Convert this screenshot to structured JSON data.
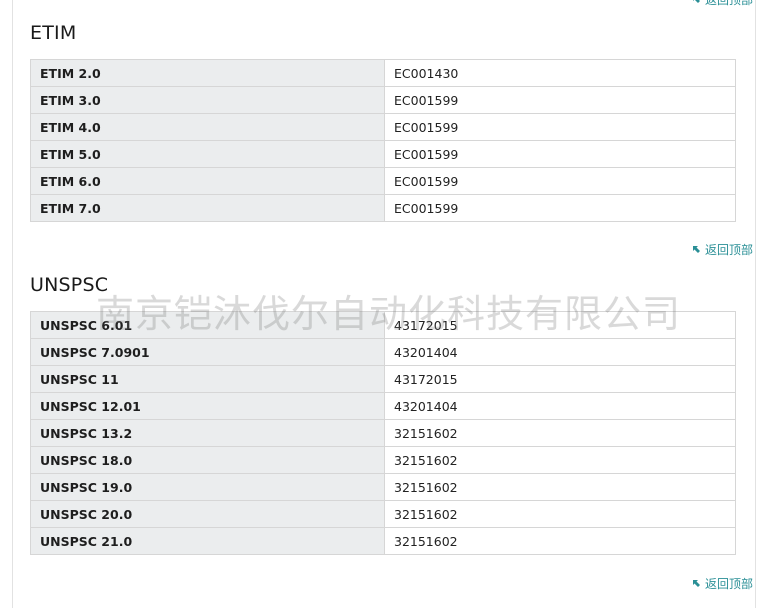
{
  "back_to_top_label": "返回顶部",
  "etim": {
    "title": "ETIM",
    "rows": [
      {
        "key": "ETIM 2.0",
        "value": "EC001430"
      },
      {
        "key": "ETIM 3.0",
        "value": "EC001599"
      },
      {
        "key": "ETIM 4.0",
        "value": "EC001599"
      },
      {
        "key": "ETIM 5.0",
        "value": "EC001599"
      },
      {
        "key": "ETIM 6.0",
        "value": "EC001599"
      },
      {
        "key": "ETIM 7.0",
        "value": "EC001599"
      }
    ]
  },
  "unspsc": {
    "title": "UNSPSC",
    "rows": [
      {
        "key": "UNSPSC 6.01",
        "value": "43172015"
      },
      {
        "key": "UNSPSC 7.0901",
        "value": "43201404"
      },
      {
        "key": "UNSPSC 11",
        "value": "43172015"
      },
      {
        "key": "UNSPSC 12.01",
        "value": "43201404"
      },
      {
        "key": "UNSPSC 13.2",
        "value": "32151602"
      },
      {
        "key": "UNSPSC 18.0",
        "value": "32151602"
      },
      {
        "key": "UNSPSC 19.0",
        "value": "32151602"
      },
      {
        "key": "UNSPSC 20.0",
        "value": "32151602"
      },
      {
        "key": "UNSPSC 21.0",
        "value": "32151602"
      }
    ]
  },
  "watermark_text": "南京铠沐伐尔自动化科技有限公司",
  "colors": {
    "link": "#2a8f96",
    "key_cell_bg": "#ebedee",
    "border": "#d6d6d6"
  }
}
